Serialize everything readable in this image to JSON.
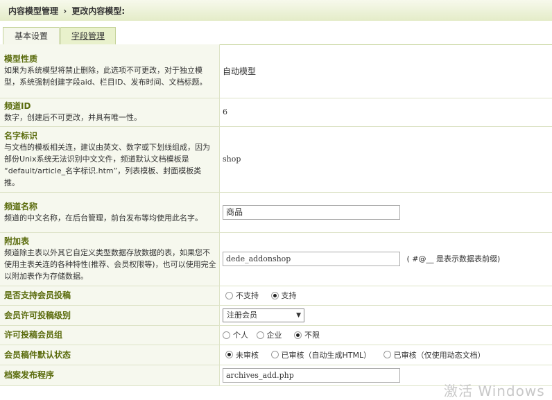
{
  "breadcrumb": {
    "root": "内容模型管理",
    "sep": "›",
    "current": "更改内容模型:"
  },
  "tabs": [
    {
      "label": "基本设置"
    },
    {
      "label": "字段管理"
    }
  ],
  "rows": {
    "model_type": {
      "title": "模型性质",
      "desc": "如果为系统模型将禁止删除，此选项不可更改，对于独立模型，系统强制创建字段aid、栏目ID、发布时间、文档标题。",
      "value": "自动模型"
    },
    "channel_id": {
      "title": "频道ID",
      "desc": "数字，创建后不可更改，并具有唯一性。",
      "value": "6"
    },
    "name_id": {
      "title": "名字标识",
      "desc": "与文档的模板相关连，建议由英文、数字或下划线组成，因为部份Unix系统无法识别中文文件，频道默认文档模板是 “default/article_名字标识.htm”，列表模板、封面模板类推。",
      "value": "shop"
    },
    "channel_name": {
      "title": "频道名称",
      "desc": "频道的中文名称，在后台管理，前台发布等均使用此名字。",
      "value": "商品"
    },
    "addon_table": {
      "title": "附加表",
      "desc": "频道除主表以外其它自定义类型数据存放数据的表，如果您不使用主表关连的各种特性(推荐、会员权限等)，也可以使用完全以附加表作为存储数据。",
      "value": "dede_addonshop",
      "note": "( #@__ 是表示数据表前缀)"
    },
    "member_submit": {
      "title": "是否支持会员投稿",
      "options": [
        "不支持",
        "支持"
      ],
      "selected": 1
    },
    "member_level": {
      "title": "会员许可投稿级别",
      "value": "注册会员"
    },
    "member_group": {
      "title": "许可投稿会员组",
      "options": [
        "个人",
        "企业",
        "不限"
      ],
      "selected": 2
    },
    "member_default_status": {
      "title": "会员稿件默认状态",
      "options": [
        "未审核",
        "已审核（自动生成HTML）",
        "已审核（仅使用动态文档）"
      ],
      "selected": 0
    },
    "publish_program": {
      "title": "档案发布程序",
      "value": "archives_add.php"
    }
  },
  "watermark": "激活 Windows"
}
